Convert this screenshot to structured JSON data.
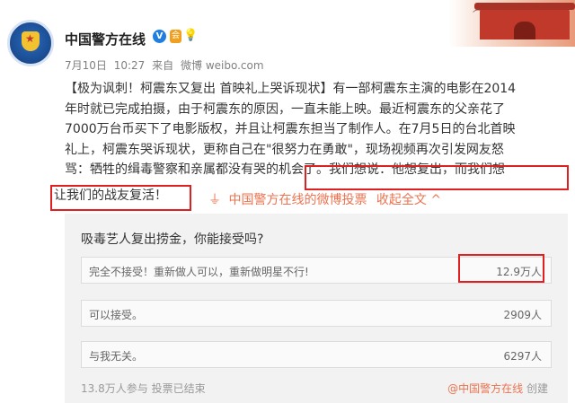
{
  "account": {
    "name": "中国警方在线",
    "verified_badge": "V",
    "badge2": "会",
    "badge3": "💡"
  },
  "meta": {
    "date": "7月10日",
    "time": "10:27",
    "from_label": "来自",
    "source": "微博 weibo.com"
  },
  "post": {
    "lines": [
      "【极为讽刺！柯震东又复出 首映礼上哭诉现状】有一部柯震东主演的电影在2014",
      "年时就已完成拍摄，由于柯震东的原因，一直未能上映。最近柯震东的父亲花了",
      "7000万台币买下了电影版权，并且让柯震东担当了制作人。在7月5日的台北首映",
      "礼上，柯震东哭诉现状，更称自己在\"很努力在勇敢\"，现场视频再次引发网友怒",
      "骂：牺牲的缉毒警察和亲属都没有哭的机会了。我们想说：他想复出，而我们想",
      "让我们的战友复活！"
    ],
    "vote_link": "中国警方在线的微博投票",
    "collapse": "收起全文 ^"
  },
  "poll": {
    "question": "吸毒艺人复出捞金，你能接受吗?",
    "options": [
      {
        "text": "完全不接受！重新做人可以，重新做明星不行!",
        "count": "12.9万人"
      },
      {
        "text": "可以接受。",
        "count": "2909人"
      },
      {
        "text": "与我无关。",
        "count": "6297人"
      }
    ],
    "participants": "13.8万人参与",
    "status": "投票已结束",
    "creator": "@中国警方在线",
    "created_label": "创建"
  },
  "colors": {
    "accent": "#eb7350",
    "highlight_border": "#e02020",
    "verified": "#1f7ee0"
  }
}
